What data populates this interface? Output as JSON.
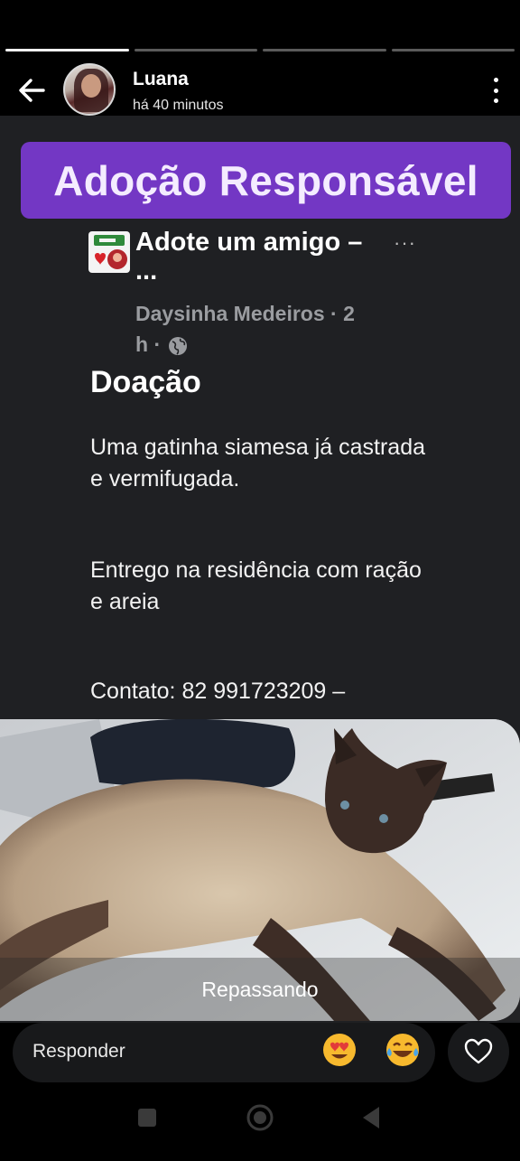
{
  "story": {
    "user_name": "Luana",
    "time_ago": "há 40 minutos",
    "progress_segments": 4,
    "active_segment": 1
  },
  "banner": {
    "text": "Adoção Responsável"
  },
  "post": {
    "group_title": "Adote um amigo – ...",
    "menu_label": "···",
    "author": "Daysinha Medeiros",
    "meta_suffix": "· 2 h ·",
    "heading": "Doação",
    "paragraphs": [
      "Uma gatinha siamesa já castrada e vermifugada.",
      "Entrego na residência com ração e areia",
      "Contato: 82 991723209 –"
    ]
  },
  "photo": {
    "caption": "Repassando"
  },
  "reply": {
    "placeholder": "Responder",
    "emojis": [
      "heart-eyes-emoji",
      "laughing-tears-emoji"
    ]
  },
  "colors": {
    "banner": "#7337c4",
    "story_bg": "#1f2023",
    "meta_text": "#9a9ca0"
  }
}
